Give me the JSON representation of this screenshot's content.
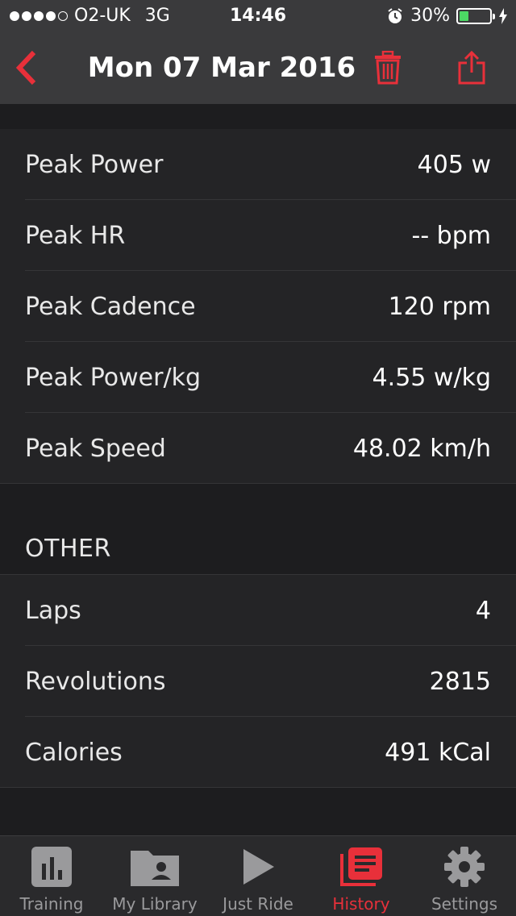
{
  "status": {
    "carrier": "O2-UK",
    "network": "3G",
    "time": "14:46",
    "battery_percent": "30%",
    "battery_level": 0.3
  },
  "nav": {
    "title": "Mon 07 Mar 2016",
    "accent": "#e8303a"
  },
  "peaks": [
    {
      "label": "Peak Power",
      "value": "405 w"
    },
    {
      "label": "Peak HR",
      "value": "-- bpm"
    },
    {
      "label": "Peak Cadence",
      "value": "120 rpm"
    },
    {
      "label": "Peak Power/kg",
      "value": "4.55 w/kg"
    },
    {
      "label": "Peak Speed",
      "value": "48.02 km/h"
    }
  ],
  "other": {
    "header": "OTHER",
    "rows": [
      {
        "label": "Laps",
        "value": "4"
      },
      {
        "label": "Revolutions",
        "value": "2815"
      },
      {
        "label": "Calories",
        "value": "491 kCal"
      }
    ]
  },
  "tabs": [
    {
      "label": "Training",
      "icon": "bar-chart-icon"
    },
    {
      "label": "My Library",
      "icon": "folder-user-icon"
    },
    {
      "label": "Just Ride",
      "icon": "play-icon"
    },
    {
      "label": "History",
      "icon": "history-list-icon"
    },
    {
      "label": "Settings",
      "icon": "gear-icon"
    }
  ]
}
